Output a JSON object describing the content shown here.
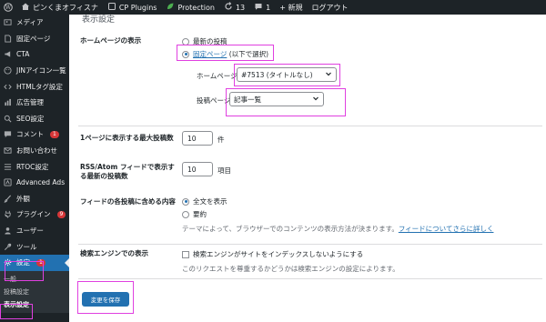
{
  "adminbar": {
    "site_name": "ピンくまオフィスナ",
    "plugin": "CP Plugins",
    "protection": "Protection",
    "updates_count": "13",
    "comments_count": "1",
    "new_label": "+ 新規",
    "logout": "ログアウト"
  },
  "sidebar": {
    "items": [
      {
        "label": "メディア",
        "icon": "media-icon"
      },
      {
        "label": "固定ページ",
        "icon": "page-icon"
      },
      {
        "label": "CTA",
        "icon": "megaphone-icon"
      },
      {
        "label": "JINアイコン一覧",
        "icon": "face-icon"
      },
      {
        "label": "HTMLタグ設定",
        "icon": "code-icon"
      },
      {
        "label": "広告管理",
        "icon": "chart-icon"
      },
      {
        "label": "SEO設定",
        "icon": "seo-icon"
      },
      {
        "label": "コメント",
        "icon": "comment-icon",
        "badge": "1"
      },
      {
        "label": "お問い合わせ",
        "icon": "mail-icon"
      },
      {
        "label": "RTOC設定",
        "icon": "list-icon"
      },
      {
        "label": "Advanced Ads",
        "icon": "ads-icon"
      },
      {
        "label": "外観",
        "icon": "brush-icon"
      },
      {
        "label": "プラグイン",
        "icon": "plugin-icon",
        "badge": "9"
      },
      {
        "label": "ユーザー",
        "icon": "user-icon"
      },
      {
        "label": "ツール",
        "icon": "wrench-icon"
      },
      {
        "label": "設定",
        "icon": "settings-icon",
        "badge": "1",
        "active": true
      }
    ],
    "submenu": [
      "一般",
      "投稿設定",
      "表示設定"
    ]
  },
  "main": {
    "page_title": "表示設定",
    "homepage": {
      "label": "ホームページの表示",
      "option_latest": "最新の投稿",
      "option_static_link": "固定ページ",
      "option_static_suffix": " (以下で選択)",
      "homepage_label": "ホームページ:",
      "homepage_value": "#7513 (タイトルなし)",
      "posts_page_label": "投稿ページ:",
      "posts_page_value": "記事一覧"
    },
    "posts_per_page": {
      "label": "1ページに表示する最大投稿数",
      "value": "10",
      "unit": "件"
    },
    "feed_items": {
      "label": "RSS/Atom フィードで表示する最新の投稿数",
      "value": "10",
      "unit": "項目"
    },
    "feed_content": {
      "label": "フィードの各投稿に含める内容",
      "option_full": "全文を表示",
      "option_summary": "要約",
      "desc_text": "テーマによって、ブラウザーでのコンテンツの表示方法が決まります。",
      "desc_link": "フィードについてさらに詳しく"
    },
    "search_engine": {
      "label": "検索エンジンでの表示",
      "checkbox_label": "検索エンジンがサイトをインデックスしないようにする",
      "desc": "このリクエストを尊重するかどうかは検索エンジンの設定によります。"
    },
    "save_button": "変更を保存"
  }
}
